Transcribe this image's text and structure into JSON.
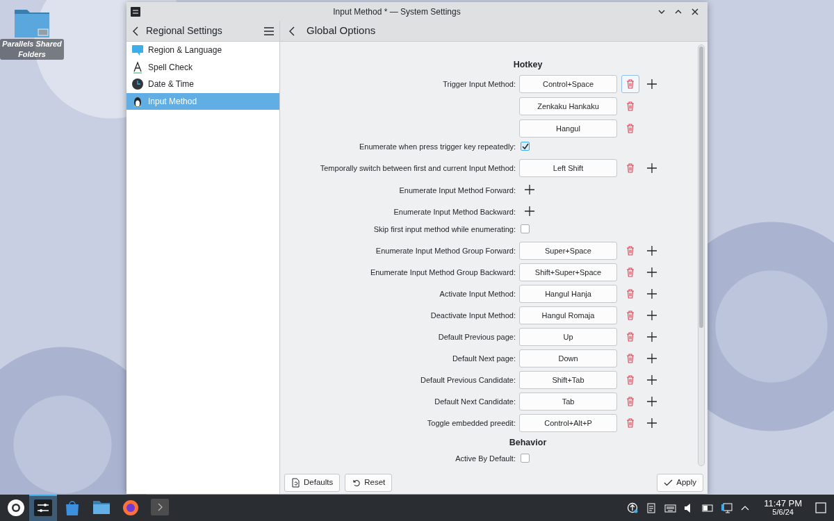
{
  "desktop": {
    "icons": [
      {
        "label": "Parallels Shared Folders"
      }
    ]
  },
  "window": {
    "title": "Input Method * — System Settings"
  },
  "sidebar": {
    "title": "Regional Settings",
    "items": [
      {
        "label": "Region & Language",
        "kind": "bubble",
        "selected": false
      },
      {
        "label": "Spell Check",
        "kind": "spell",
        "selected": false
      },
      {
        "label": "Date & Time",
        "kind": "clock",
        "selected": false
      },
      {
        "label": "Input Method",
        "kind": "penguin",
        "selected": true
      }
    ]
  },
  "page": {
    "title": "Global Options"
  },
  "rows": [
    {
      "kind": "heading",
      "label": "Hotkey"
    },
    {
      "kind": "keys",
      "label": "Trigger Input Method:",
      "keys": [
        {
          "text": "Control+Space",
          "focused": true
        },
        {
          "text": "Zenkaku Hankaku",
          "focused": false
        },
        {
          "text": "Hangul",
          "focused": false
        }
      ]
    },
    {
      "kind": "checkbox",
      "label": "Enumerate when press trigger key repeatedly:",
      "checked": true
    },
    {
      "kind": "keys",
      "label": "Temporally switch between first and current Input Method:",
      "keys": [
        {
          "text": "Left Shift",
          "focused": false
        }
      ]
    },
    {
      "kind": "add",
      "label": "Enumerate Input Method Forward:"
    },
    {
      "kind": "add",
      "label": "Enumerate Input Method Backward:"
    },
    {
      "kind": "checkbox",
      "label": "Skip first input method while enumerating:",
      "checked": false
    },
    {
      "kind": "keys",
      "label": "Enumerate Input Method Group Forward:",
      "keys": [
        {
          "text": "Super+Space",
          "focused": false
        }
      ]
    },
    {
      "kind": "keys",
      "label": "Enumerate Input Method Group Backward:",
      "keys": [
        {
          "text": "Shift+Super+Space",
          "focused": false
        }
      ]
    },
    {
      "kind": "keys",
      "label": "Activate Input Method:",
      "keys": [
        {
          "text": "Hangul Hanja",
          "focused": false
        }
      ]
    },
    {
      "kind": "keys",
      "label": "Deactivate Input Method:",
      "keys": [
        {
          "text": "Hangul Romaja",
          "focused": false
        }
      ]
    },
    {
      "kind": "keys",
      "label": "Default Previous page:",
      "keys": [
        {
          "text": "Up",
          "focused": false
        }
      ]
    },
    {
      "kind": "keys",
      "label": "Default Next page:",
      "keys": [
        {
          "text": "Down",
          "focused": false
        }
      ]
    },
    {
      "kind": "keys",
      "label": "Default Previous Candidate:",
      "keys": [
        {
          "text": "Shift+Tab",
          "focused": false
        }
      ]
    },
    {
      "kind": "keys",
      "label": "Default Next Candidate:",
      "keys": [
        {
          "text": "Tab",
          "focused": false
        }
      ]
    },
    {
      "kind": "keys",
      "label": "Toggle embedded preedit:",
      "keys": [
        {
          "text": "Control+Alt+P",
          "focused": false
        }
      ]
    },
    {
      "kind": "heading",
      "label": "Behavior"
    },
    {
      "kind": "checkbox",
      "label": "Active By Default:",
      "checked": false
    }
  ],
  "footer": {
    "buttons": [
      {
        "label": "Defaults",
        "kind": "defaults"
      },
      {
        "label": "Reset",
        "kind": "reset"
      },
      {
        "label": "Apply",
        "kind": "apply"
      }
    ]
  },
  "taskbar": {
    "apps": [
      {
        "kind": "settings",
        "selected": true
      },
      {
        "kind": "store",
        "selected": false
      },
      {
        "kind": "files",
        "selected": false
      },
      {
        "kind": "browser",
        "selected": false
      },
      {
        "kind": "terminal",
        "selected": false
      }
    ],
    "tray": [
      {
        "kind": "update"
      },
      {
        "kind": "clipboard"
      },
      {
        "kind": "keyboard"
      },
      {
        "kind": "volume"
      },
      {
        "kind": "battery"
      },
      {
        "kind": "network"
      },
      {
        "kind": "expand"
      }
    ],
    "time": "11:47 PM",
    "date": "5/6/24"
  }
}
